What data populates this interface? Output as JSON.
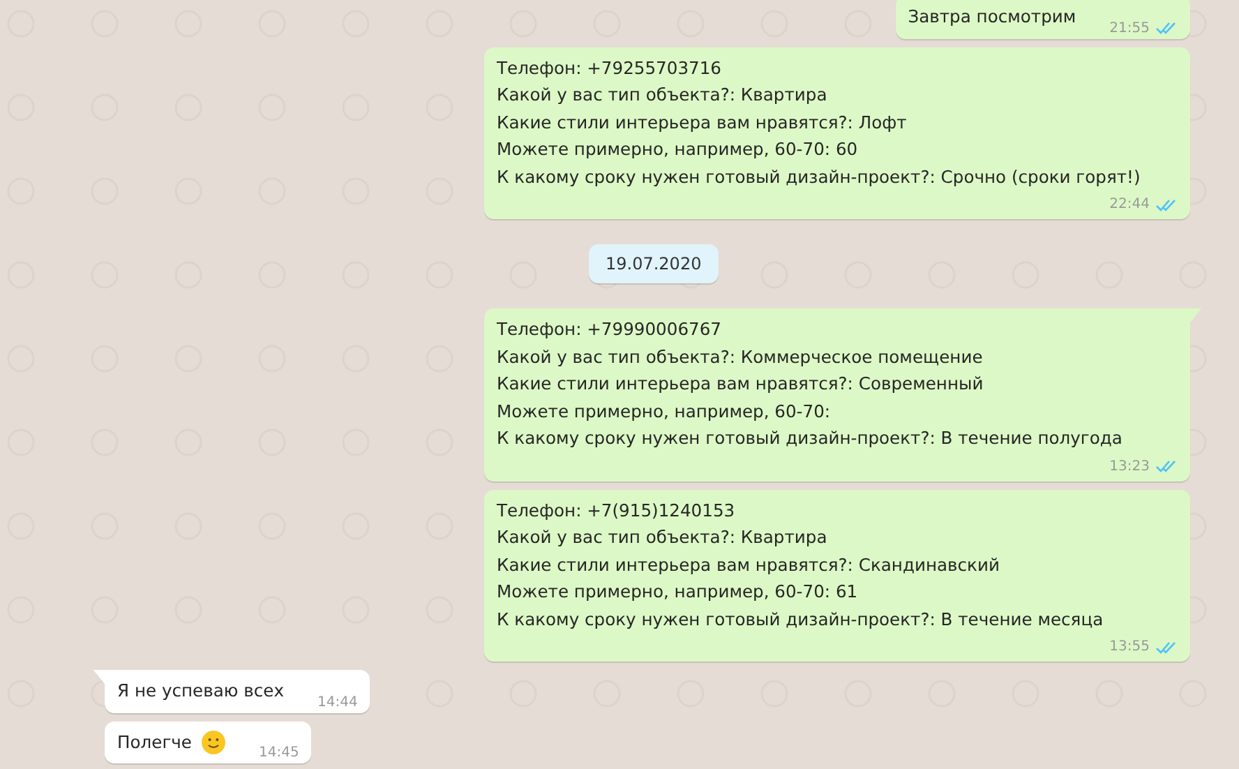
{
  "messages": [
    {
      "kind": "outgoing",
      "tail": false,
      "lines": [
        "Завтра посмотрим"
      ],
      "time": "21:55",
      "read": true
    },
    {
      "kind": "outgoing",
      "tail": false,
      "lines": [
        "Телефон: +79255703716",
        "Какой у вас тип объекта?: Квартира",
        "Какие стили интерьера вам нравятся?: Лофт",
        "Можете примерно, например, 60-70: 60",
        "К какому сроку нужен готовый дизайн-проект?: Срочно (сроки горят!)"
      ],
      "time": "22:44",
      "read": true
    },
    {
      "kind": "date",
      "text": "19.07.2020"
    },
    {
      "kind": "outgoing",
      "tail": true,
      "lines": [
        "Телефон: +79990006767",
        "Какой у вас тип объекта?: Коммерческое помещение",
        "Какие стили интерьера вам нравятся?: Современный",
        "Можете примерно, например, 60-70:",
        "К какому сроку нужен готовый дизайн-проект?: В течение полугода"
      ],
      "time": "13:23",
      "read": true
    },
    {
      "kind": "outgoing",
      "tail": false,
      "lines": [
        "Телефон: +7(915)1240153",
        "Какой у вас тип объекта?: Квартира",
        "Какие стили интерьера вам нравятся?: Скандинавский",
        "Можете примерно, например, 60-70: 61",
        "К какому сроку нужен готовый дизайн-проект?: В течение месяца"
      ],
      "time": "13:55",
      "read": true
    },
    {
      "kind": "incoming",
      "tail": true,
      "lines": [
        "Я не успеваю всех"
      ],
      "time": "14:44"
    },
    {
      "kind": "incoming",
      "tail": false,
      "lines": [
        "Полегче"
      ],
      "emoji": true,
      "time": "14:45"
    }
  ]
}
